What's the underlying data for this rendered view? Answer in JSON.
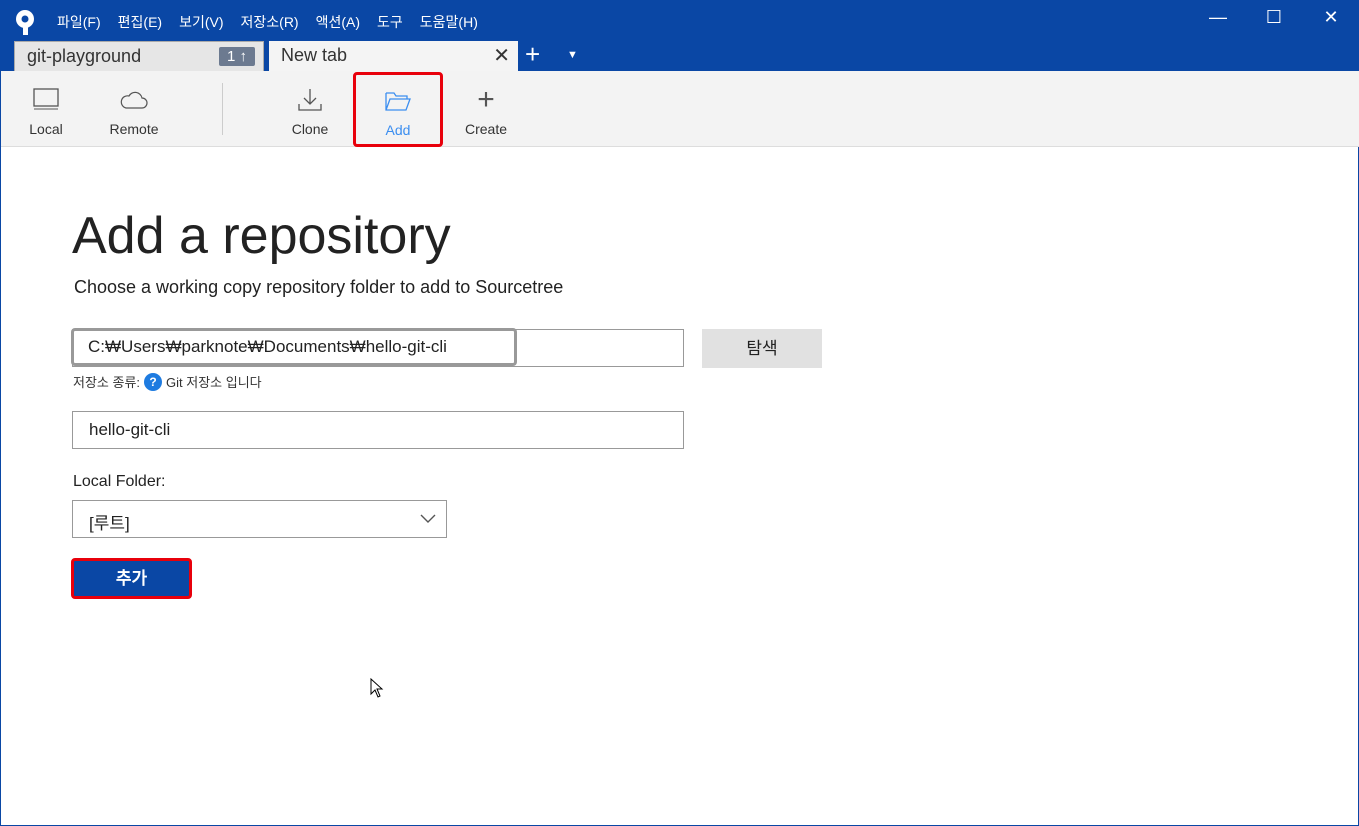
{
  "menu": [
    "파일(F)",
    "편집(E)",
    "보기(V)",
    "저장소(R)",
    "액션(A)",
    "도구",
    "도움말(H)"
  ],
  "tabs": {
    "repo": "git-playground",
    "repo_badge": "1 ↑",
    "new": "New tab"
  },
  "toolbar": {
    "local": "Local",
    "remote": "Remote",
    "clone": "Clone",
    "add": "Add",
    "create": "Create"
  },
  "page": {
    "title": "Add a repository",
    "subtitle": "Choose a working copy repository folder to add to Sourcetree",
    "path": "C:₩Users₩parknote₩Documents₩hello-git-cli",
    "browse": "탐색",
    "repo_type_label": "저장소 종류:",
    "repo_type_value": "Git 저장소 입니다",
    "name": "hello-git-cli",
    "local_folder_label": "Local Folder:",
    "local_folder": "[루트]",
    "add_button": "추가"
  },
  "colors": {
    "brand": "#0a47a5",
    "highlight": "#e8000b",
    "active": "#3b8ef0"
  }
}
